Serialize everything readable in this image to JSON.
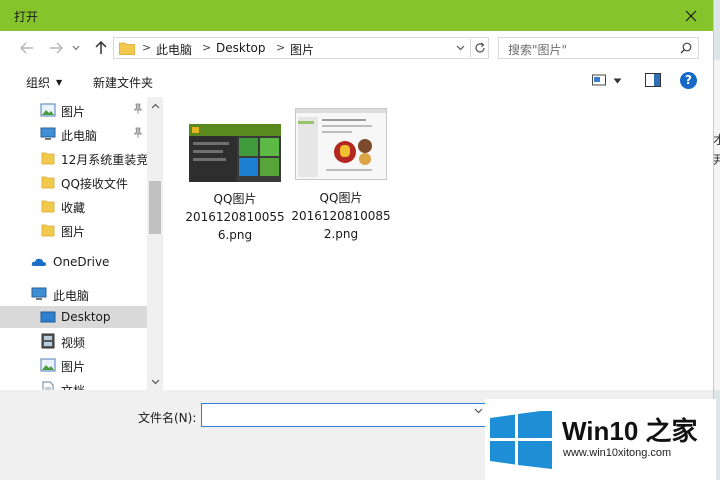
{
  "window": {
    "title": "打开",
    "close_label": "×"
  },
  "address": {
    "breadcrumb": [
      "此电脑",
      "Desktop",
      "图片"
    ],
    "separator": ">"
  },
  "search": {
    "placeholder": "搜索\"图片\""
  },
  "toolbar": {
    "organize": "组织",
    "new_folder": "新建文件夹"
  },
  "nav": {
    "items": [
      {
        "label": "图片",
        "icon": "pictures-icon",
        "pinned": true
      },
      {
        "label": "此电脑",
        "icon": "computer-icon",
        "pinned": true
      },
      {
        "label": "12月系统重装竞",
        "icon": "folder-icon"
      },
      {
        "label": "QQ接收文件",
        "icon": "folder-icon"
      },
      {
        "label": "收藏",
        "icon": "folder-icon"
      },
      {
        "label": "图片",
        "icon": "folder-icon"
      },
      {
        "label": "OneDrive",
        "icon": "onedrive-icon"
      },
      {
        "label": "此电脑",
        "icon": "computer-icon"
      },
      {
        "label": "Desktop",
        "icon": "desktop-icon",
        "selected": true
      },
      {
        "label": "视频",
        "icon": "videos-icon"
      },
      {
        "label": "图片",
        "icon": "pictures-icon"
      },
      {
        "label": "文档",
        "icon": "documents-icon"
      }
    ]
  },
  "files": [
    {
      "name": "QQ图片20161208100556.png",
      "line1": "QQ图片",
      "line2": "2016120810055",
      "line3": "6.png"
    },
    {
      "name": "QQ图片20161208100852.png",
      "line1": "QQ图片",
      "line2": "2016120810085",
      "line3": "2.png"
    }
  ],
  "filename": {
    "label": "文件名(N):",
    "value": ""
  },
  "watermark": {
    "title": "Win10 之家",
    "url": "www.win10xitong.com"
  },
  "background": {
    "chars": [
      "才",
      "尹"
    ]
  },
  "colors": {
    "titlebar": "#86c42b",
    "accent_blue": "#1669c7",
    "win_logo_blue": "#1e8fd6"
  }
}
